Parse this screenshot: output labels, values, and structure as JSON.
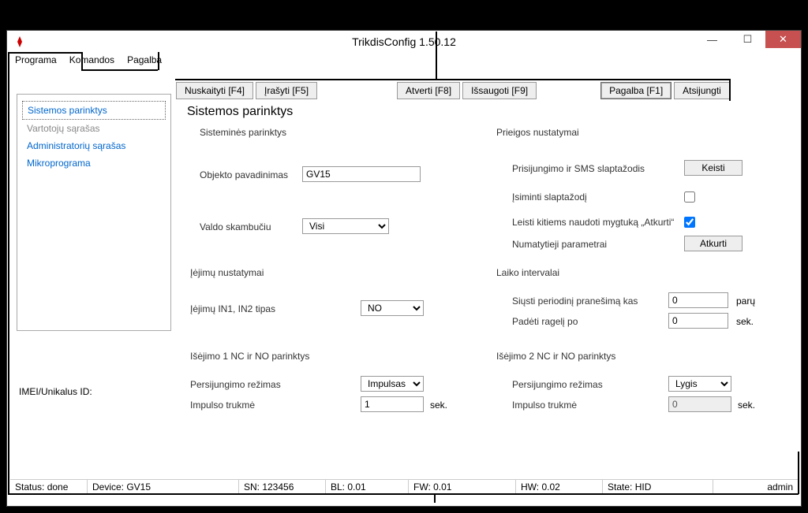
{
  "title": "TrikdisConfig 1.50.12",
  "menu": {
    "program": "Programa",
    "commands": "Komandos",
    "help": "Pagalba"
  },
  "toolbar": {
    "read": "Nuskaityti [F4]",
    "write": "Įrašyti [F5]",
    "open": "Atverti [F8]",
    "save": "Išsaugoti [F9]",
    "helpbtn": "Pagalba [F1]",
    "logout": "Atsijungti"
  },
  "sidebar": {
    "items": [
      "Sistemos parinktys",
      "Vartotojų sąrašas",
      "Administratorių sąrašas",
      "Mikroprograma"
    ]
  },
  "imei_label": "IMEI/Unikalus ID:",
  "page_title": "Sistemos parinktys",
  "groups": {
    "sys": "Sisteminės parinktys",
    "access": "Prieigos nustatymai",
    "inputs": "Įėjimų nustatymai",
    "time": "Laiko intervalai",
    "out1": "Išėjimo 1 NC ir NO parinktys",
    "out2": "Išėjimo 2 NC ir NO parinktys"
  },
  "fields": {
    "object_name_label": "Objekto pavadinimas",
    "object_name_value": "GV15",
    "controls_call_label": "Valdo skambučiu",
    "controls_call_value": "Visi",
    "login_pass_label": "Prisijungimo ir SMS slaptažodis",
    "change_btn": "Keisti",
    "remember_label": "Įsiminti slaptažodį",
    "remember_checked": false,
    "allow_restore_label": "Leisti kitiems naudoti mygtuką „Atkurti“",
    "allow_restore_checked": true,
    "defaults_label": "Numatytieji parametrai",
    "restore_btn": "Atkurti",
    "in_type_label": "Įėjimų IN1, IN2 tipas",
    "in_type_value": "NO",
    "periodic_label": "Siųsti periodinį pranešimą kas",
    "periodic_value": "0",
    "periodic_unit": "parų",
    "hangup_label": "Padėti ragelį po",
    "hangup_value": "0",
    "hangup_unit": "sek.",
    "switch_mode_label": "Persijungimo režimas",
    "switch_mode1_value": "Impulsas",
    "switch_mode2_value": "Lygis",
    "pulse_len_label": "Impulso trukmė",
    "pulse_len1_value": "1",
    "pulse_len2_value": "0",
    "pulse_unit": "sek."
  },
  "status": {
    "status": "Status: done",
    "device": "Device: GV15",
    "sn": "SN: 123456",
    "bl": "BL: 0.01",
    "fw": "FW: 0.01",
    "hw": "HW: 0.02",
    "state": "State: HID",
    "user": "admin"
  }
}
